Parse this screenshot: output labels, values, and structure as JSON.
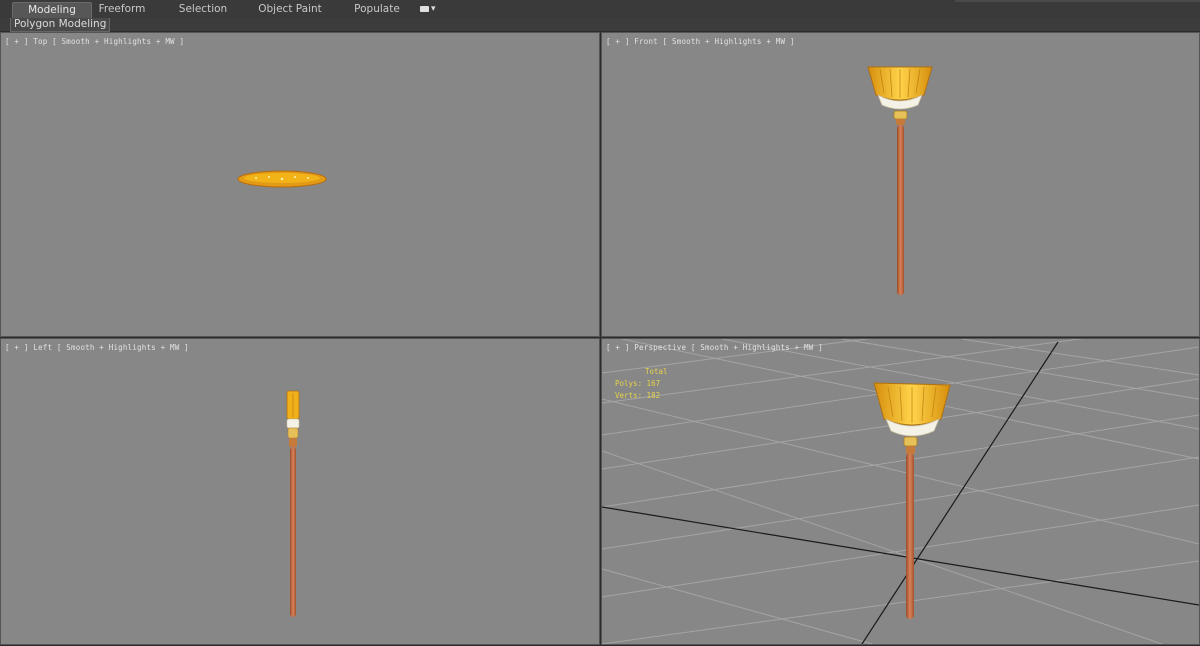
{
  "ribbon": {
    "tabs": [
      {
        "label": "Modeling",
        "active": true
      },
      {
        "label": "Freeform",
        "active": false
      },
      {
        "label": "Selection",
        "active": false
      },
      {
        "label": "Object Paint",
        "active": false
      },
      {
        "label": "Populate",
        "active": false
      }
    ],
    "camera_dropdown_icon": "camera-dropdown-icon"
  },
  "subbar": {
    "panel_label": "Polygon Modeling"
  },
  "viewports": {
    "top": {
      "label": "[ + ] Top [ Smooth + Highlights + MW ]"
    },
    "front": {
      "label": "[ + ] Front [ Smooth + Highlights + MW ]"
    },
    "left": {
      "label": "[ + ] Left [ Smooth + Highlights + MW ]"
    },
    "perspective": {
      "label": "[ + ] Perspective [ Smooth + Highlights + MW ]",
      "stats": {
        "header": "Total",
        "polys": "Polys: 167",
        "verts": "Verts: 182"
      }
    }
  },
  "colors": {
    "viewport_bg": "#878787",
    "broom_handle": "#c5683a",
    "broom_bristle": "#f2b318",
    "stats_text": "#e7d24a"
  }
}
